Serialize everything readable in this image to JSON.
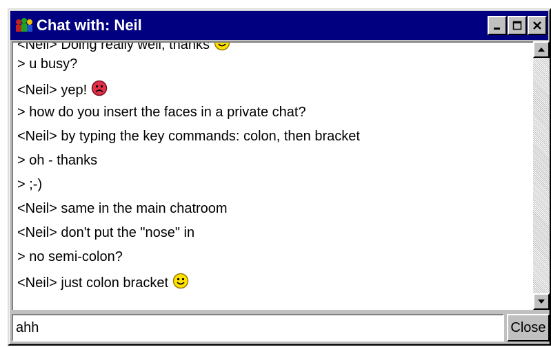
{
  "window": {
    "title": "Chat with: Neil",
    "app_icon": "people-icon",
    "controls": [
      "minimize-icon",
      "maximize-icon",
      "close-x-icon"
    ]
  },
  "messages": [
    {
      "text": "<Neil> Doing really well, thanks",
      "face": "smile"
    },
    {
      "text": "> u busy?",
      "face": null
    },
    {
      "text": "<Neil> yep!",
      "face": "sad"
    },
    {
      "text": "> how do you insert the faces in a private chat?",
      "face": null
    },
    {
      "text": "<Neil> by typing the key commands: colon, then bracket",
      "face": null
    },
    {
      "text": "> oh - thanks",
      "face": null
    },
    {
      "text": "> ;-)",
      "face": null
    },
    {
      "text": "<Neil> same in the main chatroom",
      "face": null
    },
    {
      "text": "<Neil> don't put the \"nose\" in",
      "face": null
    },
    {
      "text": "> no semi-colon?",
      "face": null
    },
    {
      "text": "<Neil> just colon bracket",
      "face": "smile"
    }
  ],
  "scrollbar": {
    "up_icon": "arrow-up-icon",
    "down_icon": "arrow-down-icon"
  },
  "input": {
    "value": "ahh"
  },
  "close_button": {
    "label": "Close"
  },
  "colors": {
    "titlebar": "#000080",
    "face_happy": "#ffe100",
    "face_sad": "#e0304a",
    "window_gray": "#c0c0c0"
  }
}
